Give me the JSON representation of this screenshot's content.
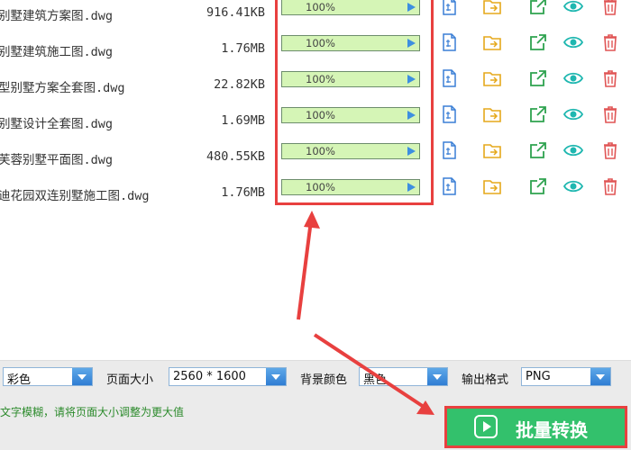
{
  "files": [
    {
      "name": "别墅建筑方案图.dwg",
      "size": "916.41KB",
      "progress_label": "100%",
      "progress": 1.0
    },
    {
      "name": "别墅建筑施工图.dwg",
      "size": "1.76MB",
      "progress_label": "100%",
      "progress": 1.0
    },
    {
      "name": "型别墅方案全套图.dwg",
      "size": "22.82KB",
      "progress_label": "100%",
      "progress": 1.0
    },
    {
      "name": "别墅设计全套图.dwg",
      "size": "1.69MB",
      "progress_label": "100%",
      "progress": 1.0
    },
    {
      "name": "芙蓉别墅平面图.dwg",
      "size": "480.55KB",
      "progress_label": "100%",
      "progress": 1.0
    },
    {
      "name": "迪花园双连别墅施工图.dwg",
      "size": "1.76MB",
      "progress_label": "100%",
      "progress": 1.0
    }
  ],
  "toolbar": {
    "color_mode": "彩色",
    "page_size_label": "页面大小",
    "page_size": "2560 * 1600",
    "bg_color_label": "背景颜色",
    "bg_color": "黑色",
    "output_format_label": "输出格式",
    "output_format": "PNG"
  },
  "hint": "文字模糊，请将页面大小调整为更大值",
  "convert_button": "批量转换",
  "colors": {
    "accent_green": "#33c16c",
    "highlight_red": "#e8403f",
    "progress_fill": "#d5f5b6"
  },
  "row_icons": [
    "document-icon",
    "folder-icon",
    "open-external-icon",
    "eye-icon",
    "trash-icon"
  ]
}
